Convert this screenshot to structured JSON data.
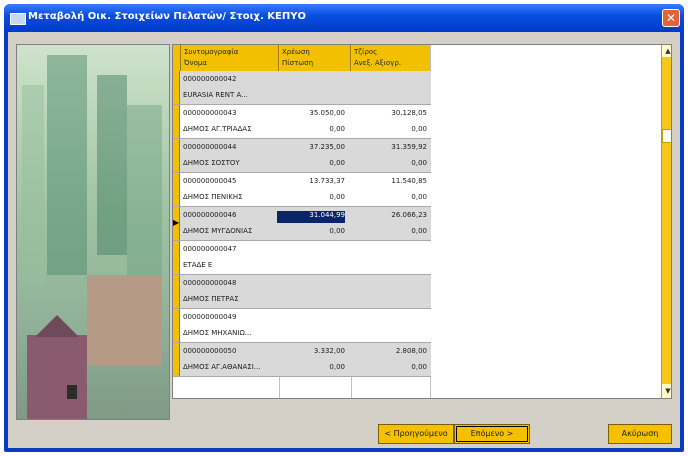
{
  "window": {
    "title": "Μεταβολή Οικ. Στοιχείων Πελατών/ Στοιχ. ΚΕΠΥΟ"
  },
  "grid": {
    "headers": [
      {
        "line1": "Συντομογραφία",
        "line2": "Όνομα"
      },
      {
        "line1": "Χρέωση",
        "line2": "Πίστωση"
      },
      {
        "line1": "Τζίρος",
        "line2": "Ανεξ. Αξιογρ."
      }
    ],
    "rows": [
      {
        "code": "000000000042",
        "name": "EURASIA RENT A...",
        "debit": "",
        "turnover": "",
        "credit": "",
        "extra": ""
      },
      {
        "code": "000000000043",
        "name": "ΔΗΜΟΣ ΑΓ.ΤΡΙΑΔΑΣ",
        "debit": "35.050,00",
        "turnover": "30.128,05",
        "credit": "0,00",
        "extra": "0,00"
      },
      {
        "code": "000000000044",
        "name": "ΔΗΜΟΣ ΣΟΣΤΟΥ",
        "debit": "37.235,00",
        "turnover": "31.359,92",
        "credit": "0,00",
        "extra": "0,00"
      },
      {
        "code": "000000000045",
        "name": "ΔΗΜΟΣ ΠΕΝΙΚΗΣ",
        "debit": "13.733,37",
        "turnover": "11.540,85",
        "credit": "0,00",
        "extra": "0,00"
      },
      {
        "code": "000000000046",
        "name": "ΔΗΜΟΣ ΜΥΓΔΟΝΙΑΣ",
        "debit": "31.044,99",
        "turnover": "26.066,23",
        "credit": "0,00",
        "extra": "0,00",
        "selected": true
      },
      {
        "code": "000000000047",
        "name": "ΕΤΑΔΕ Ε",
        "debit": "",
        "turnover": "",
        "credit": "",
        "extra": ""
      },
      {
        "code": "000000000048",
        "name": "ΔΗΜΟΣ ΠΕΤΡΑΣ",
        "debit": "",
        "turnover": "",
        "credit": "",
        "extra": ""
      },
      {
        "code": "000000000049",
        "name": "ΔΗΜΟΣ ΜΗΧΑΝΙΩ...",
        "debit": "",
        "turnover": "",
        "credit": "",
        "extra": ""
      },
      {
        "code": "000000000050",
        "name": "ΔΗΜΟΣ ΑΓ.ΑΘΑΝΑΣΙ...",
        "debit": "3.332,00",
        "turnover": "2.808,00",
        "credit": "0,00",
        "extra": "0,00"
      }
    ]
  },
  "buttons": {
    "prev": "< Προηγούμενο",
    "next": "Επόμενο >",
    "cancel": "Ακύρωση"
  },
  "colors": {
    "accent": "#f2c000",
    "titlebar": "#0a4fe0",
    "selected": "#0a246a"
  }
}
